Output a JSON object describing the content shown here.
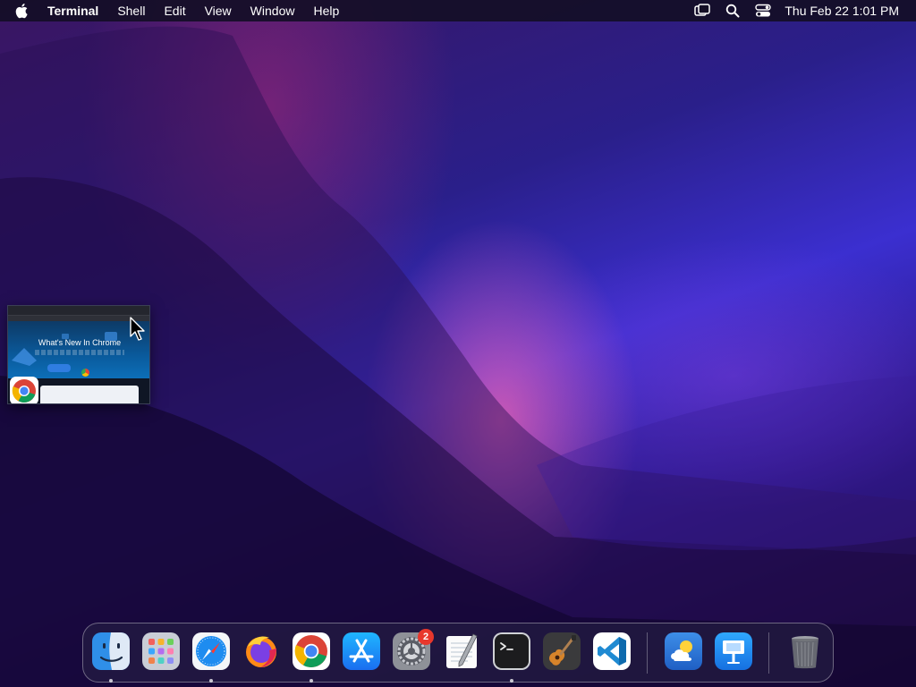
{
  "menubar": {
    "apple_icon": "apple-logo-icon",
    "app_name": "Terminal",
    "menus": [
      "Shell",
      "Edit",
      "View",
      "Window",
      "Help"
    ],
    "status_icons": [
      "screen-mirroring-icon",
      "spotlight-search-icon",
      "control-center-icon"
    ],
    "clock": "Thu Feb 22  1:01 PM"
  },
  "window_thumbnail": {
    "app": "Google Chrome",
    "page_title": "What's New In Chrome",
    "app_icon": "chrome-icon"
  },
  "dock": {
    "items": [
      {
        "name": "Finder",
        "icon": "finder-icon",
        "running": true
      },
      {
        "name": "Launchpad",
        "icon": "launchpad-icon",
        "running": false
      },
      {
        "name": "Safari",
        "icon": "safari-icon",
        "running": true
      },
      {
        "name": "Firefox",
        "icon": "firefox-icon",
        "running": false
      },
      {
        "name": "Google Chrome",
        "icon": "chrome-icon",
        "running": true
      },
      {
        "name": "App Store",
        "icon": "app-store-icon",
        "running": false
      },
      {
        "name": "System Settings",
        "icon": "settings-gear-icon",
        "running": false,
        "badge": "2"
      },
      {
        "name": "TextEdit",
        "icon": "textedit-icon",
        "running": false
      },
      {
        "name": "Terminal",
        "icon": "terminal-icon",
        "running": true
      },
      {
        "name": "GarageBand",
        "icon": "garageband-guitar-icon",
        "running": false
      },
      {
        "name": "Visual Studio Code",
        "icon": "vscode-icon",
        "running": false
      },
      {
        "name": "Weather",
        "icon": "weather-icon",
        "running": false
      },
      {
        "name": "Keynote",
        "icon": "keynote-icon",
        "running": false
      },
      {
        "name": "Trash",
        "icon": "trash-icon",
        "running": false
      }
    ]
  },
  "colors": {
    "menubar_bg": "#140e26",
    "badge_red": "#e8372c",
    "wallpaper_blue": "#3b2fd0",
    "wallpaper_magenta": "#a0289a"
  }
}
